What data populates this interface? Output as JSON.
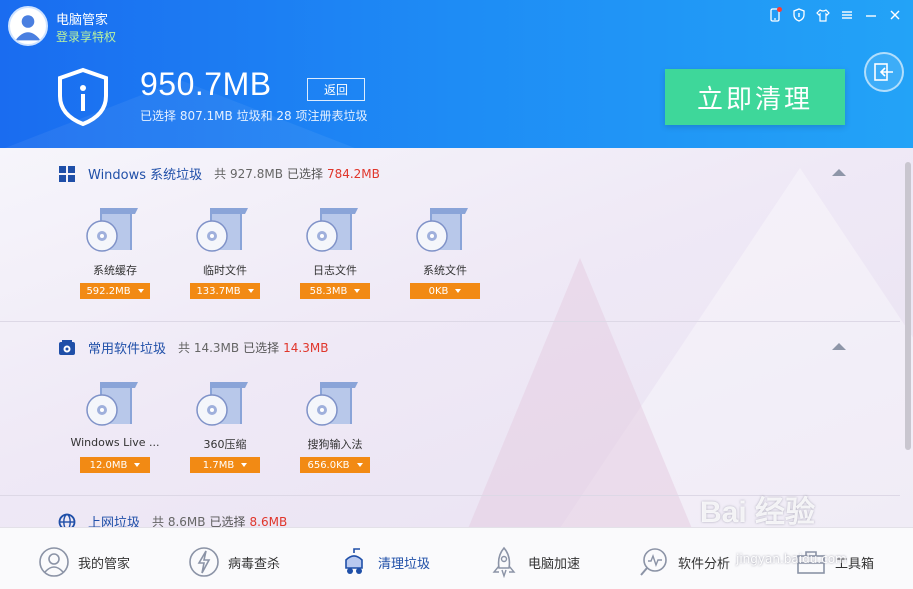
{
  "app": {
    "title": "电脑管家",
    "login_text": "登录享特权"
  },
  "summary": {
    "size_value": "950.7MB",
    "back_label": "返回",
    "selection_text": "已选择 807.1MB 垃圾和 28 项注册表垃圾",
    "clean_button": "立即清理"
  },
  "sections": [
    {
      "title": "Windows 系统垃圾",
      "total": "共 927.8MB",
      "selected_label": "已选择",
      "selected_value": "784.2MB",
      "icon": "windows-icon",
      "items": [
        {
          "label": "系统缓存",
          "size": "592.2MB"
        },
        {
          "label": "临时文件",
          "size": "133.7MB"
        },
        {
          "label": "日志文件",
          "size": "58.3MB"
        },
        {
          "label": "系统文件",
          "size": "0KB"
        }
      ]
    },
    {
      "title": "常用软件垃圾",
      "total": "共 14.3MB",
      "selected_label": "已选择",
      "selected_value": "14.3MB",
      "icon": "software-icon",
      "items": [
        {
          "label": "Windows Live ...",
          "size": "12.0MB"
        },
        {
          "label": "360压缩",
          "size": "1.7MB"
        },
        {
          "label": "搜狗输入法",
          "size": "656.0KB"
        }
      ]
    },
    {
      "title": "上网垃圾",
      "total": "共 8.6MB",
      "selected_label": "已选择",
      "selected_value": "8.6MB",
      "icon": "globe-icon"
    }
  ],
  "nav": [
    {
      "label": "我的管家",
      "icon": "butler-icon"
    },
    {
      "label": "病毒查杀",
      "icon": "virus-scan-icon"
    },
    {
      "label": "清理垃圾",
      "icon": "cleanup-icon",
      "active": true
    },
    {
      "label": "电脑加速",
      "icon": "rocket-icon"
    },
    {
      "label": "软件分析",
      "icon": "analysis-icon"
    },
    {
      "label": "工具箱",
      "icon": "toolbox-icon"
    }
  ],
  "watermark": {
    "brand": "Bai 经验",
    "url": "jingyan.baidu.com"
  },
  "colors": {
    "header_start": "#1a6cf0",
    "header_end": "#23a3f7",
    "clean_button": "#3ed79a",
    "chip": "#f28a14",
    "section_title": "#1f4fa8",
    "selected_red": "#e0362b"
  }
}
